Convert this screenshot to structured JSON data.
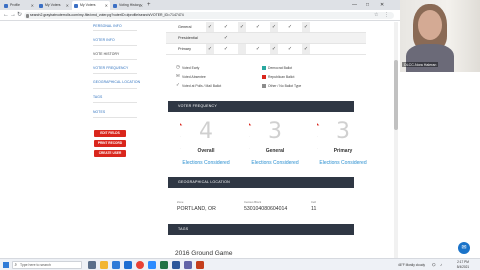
{
  "browser": {
    "tabs": [
      {
        "label": "Profile"
      },
      {
        "label": "My Voters"
      },
      {
        "label": "My Voters"
      },
      {
        "label": "Voting History"
      }
    ],
    "url": "search2.grayhatrvoterrolls.com/my-file/cmd_voter.pg?voterID=#profile/search/VOTER_ID=7147474",
    "window_controls": {
      "minimize": "—",
      "maximize": "□",
      "close": "✕"
    }
  },
  "sidebar": {
    "items": [
      {
        "label": "PERSONAL INFO"
      },
      {
        "label": "VOTER INFO"
      },
      {
        "label": "VOTE HISTORY"
      },
      {
        "label": "VOTER FREQUENCY"
      },
      {
        "label": "GEOGRAPHICAL LOCATION"
      },
      {
        "label": "TAGS"
      },
      {
        "label": "NOTES"
      }
    ],
    "buttons": {
      "edit": "EDIT FIELDS",
      "print": "PRINT RECORD",
      "create": "CREATE USER"
    }
  },
  "history": {
    "rows": [
      {
        "label": "General",
        "marks": [
          "✓",
          "✓",
          "✓",
          "✓",
          "✓",
          "✓",
          "✓",
          ""
        ]
      },
      {
        "label": "Presidential",
        "marks": [
          "",
          "✓",
          "",
          "",
          "",
          "",
          "",
          ""
        ]
      },
      {
        "label": "Primary",
        "marks": [
          "✓",
          "✓",
          "",
          "✓",
          "✓",
          "✓",
          "✓",
          ""
        ]
      }
    ]
  },
  "legend": {
    "voted_early": "Voted Early",
    "voted_absentee": "Voted Absentee",
    "voted_polls": "Voted at Polls / Mail Ballot",
    "dem": "Democrat Ballot",
    "rep": "Republican Ballot",
    "other": "Other / No Ballot Type",
    "colors": {
      "dem": "#2aa8a0",
      "rep": "#d9261c",
      "other": "#8c8c8c"
    }
  },
  "frequency": {
    "header": "VOTER FREQUENCY",
    "columns": [
      {
        "value": "4",
        "title": "Overall",
        "link": "Elections Considered"
      },
      {
        "value": "3",
        "title": "General",
        "link": "Elections Considered"
      },
      {
        "value": "3",
        "title": "Primary",
        "link": "Elections Considered"
      }
    ]
  },
  "geo": {
    "header": "GEOGRAPHICAL LOCATION",
    "fields": [
      {
        "label": "Zone",
        "value": "PORTLAND, OR"
      },
      {
        "label": "Census Block",
        "value": "530104080604014"
      },
      {
        "label": "Cell",
        "value": "11"
      }
    ]
  },
  "tags": {
    "header": "TAGS",
    "first": "2016 Ground Game"
  },
  "video": {
    "name": "DLCC-Nora Haleran"
  },
  "taskbar": {
    "search_placeholder": "Type here to search",
    "weather": "46°F Mostly cloudy",
    "time": "2:17 PM",
    "date": "5/4/2021"
  }
}
